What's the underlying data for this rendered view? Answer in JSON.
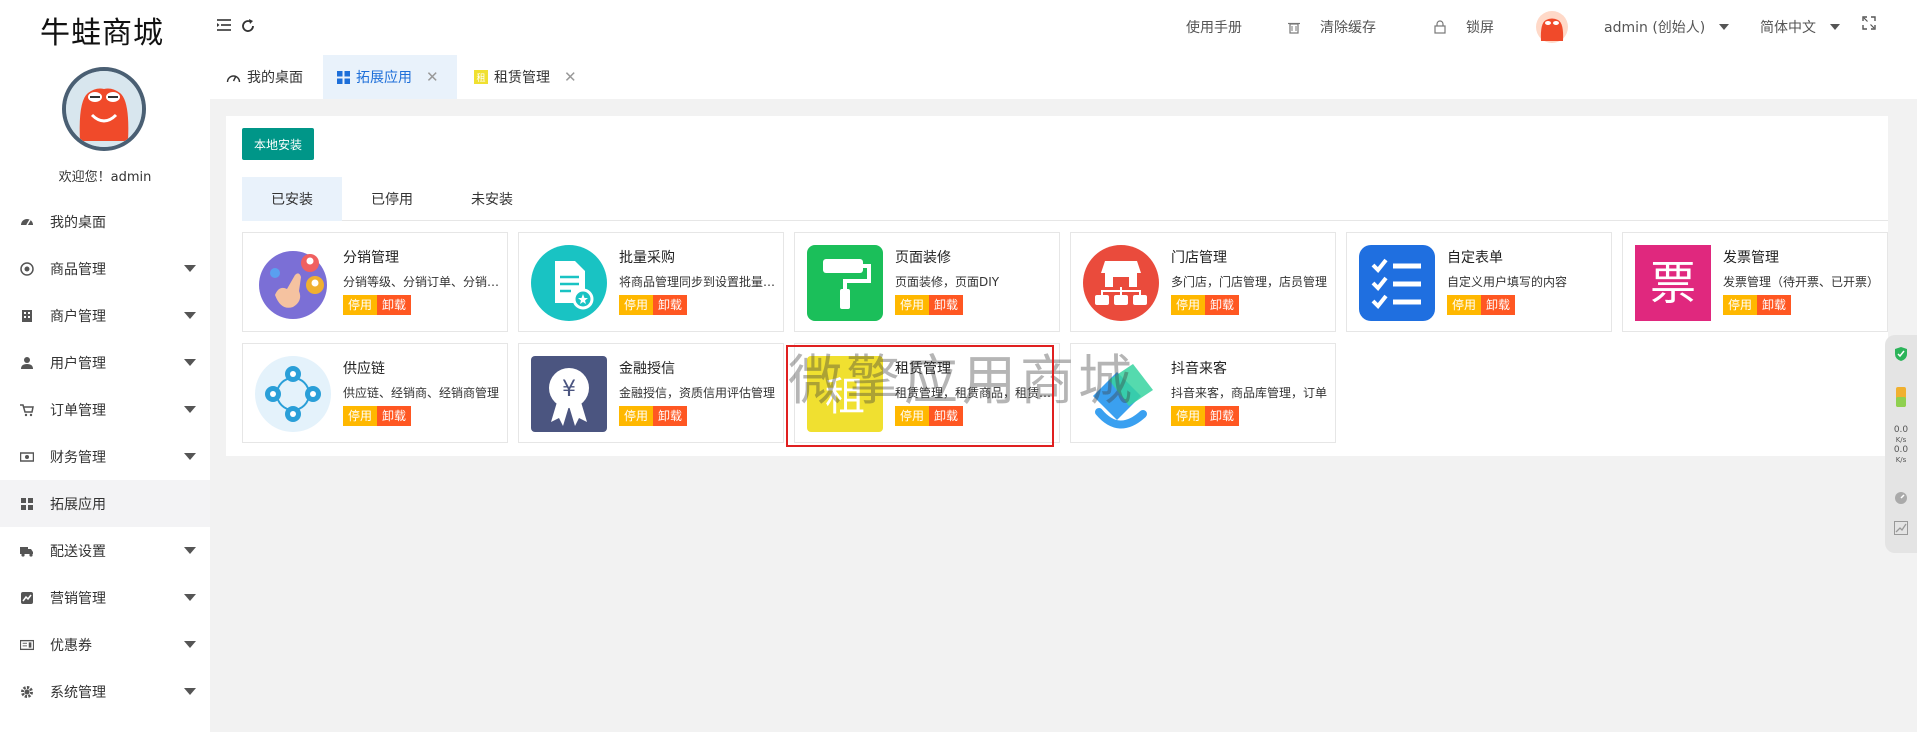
{
  "brand": "牛蛙商城",
  "welcome": "欢迎您！admin",
  "menu": [
    {
      "label": "我的桌面",
      "icon": "dashboard-icon",
      "caret": false
    },
    {
      "label": "商品管理",
      "icon": "goods-icon",
      "caret": true
    },
    {
      "label": "商户管理",
      "icon": "merchant-icon",
      "caret": true
    },
    {
      "label": "用户管理",
      "icon": "user-icon",
      "caret": true
    },
    {
      "label": "订单管理",
      "icon": "cart-icon",
      "caret": true
    },
    {
      "label": "财务管理",
      "icon": "finance-icon",
      "caret": true
    },
    {
      "label": "拓展应用",
      "icon": "grid-icon",
      "caret": false
    },
    {
      "label": "配送设置",
      "icon": "truck-icon",
      "caret": true
    },
    {
      "label": "营销管理",
      "icon": "marketing-icon",
      "caret": true
    },
    {
      "label": "优惠券",
      "icon": "coupon-icon",
      "caret": true
    },
    {
      "label": "系统管理",
      "icon": "gear-icon",
      "caret": true
    }
  ],
  "header": {
    "manual": "使用手册",
    "clear_cache": "清除缓存",
    "lock": "锁屏",
    "user": "admin (创始人)",
    "language": "简体中文"
  },
  "page_tabs": [
    {
      "label": "我的桌面"
    },
    {
      "label": "拓展应用"
    },
    {
      "label": "租赁管理"
    }
  ],
  "install_button": "本地安装",
  "sub_tabs": [
    "已安装",
    "已停用",
    "未安装"
  ],
  "buttons": {
    "stop": "停用",
    "uninstall": "卸载"
  },
  "apps": [
    {
      "title": "分销管理",
      "desc": "分销等级、分销订单、分销商管理",
      "icon": "distribution-icon",
      "color": "#7b6fd6"
    },
    {
      "title": "批量采购",
      "desc": "将商品管理同步到设置批量采购",
      "icon": "purchase-icon",
      "color": "#19c3c3"
    },
    {
      "title": "页面装修",
      "desc": "页面装修，页面DIY",
      "icon": "paint-roller-icon",
      "color": "#1bbf5a"
    },
    {
      "title": "门店管理",
      "desc": "多门店，门店管理，店员管理",
      "icon": "store-icon",
      "color": "#ea4b3c"
    },
    {
      "title": "自定表单",
      "desc": "自定义用户填写的内容",
      "icon": "checklist-icon",
      "color": "#1f6fe0"
    },
    {
      "title": "发票管理",
      "desc": "发票管理（待开票、已开票）",
      "icon": "invoice-icon",
      "color": "#e0287e",
      "glyph": "票"
    },
    {
      "title": "供应链",
      "desc": "供应链、经销商、经销商管理",
      "icon": "supply-chain-icon",
      "color": "#2a9fd8"
    },
    {
      "title": "金融授信",
      "desc": "金融授信，资质信用评估管理",
      "icon": "finance-credit-icon",
      "color": "#4b5580",
      "glyph": "¥"
    },
    {
      "title": "租赁管理",
      "desc": "租赁管理，租赁商品，租赁订单",
      "icon": "rent-icon",
      "color": "#f0e030",
      "glyph": "租"
    },
    {
      "title": "抖音来客",
      "desc": "抖音来客，商品库管理，订单",
      "icon": "douyin-icon",
      "color": "#3aa0f0"
    }
  ],
  "watermark": "微擎应用商城",
  "widget": {
    "up_speed": "0.0",
    "down_speed": "0.0",
    "unit": "K/s"
  }
}
